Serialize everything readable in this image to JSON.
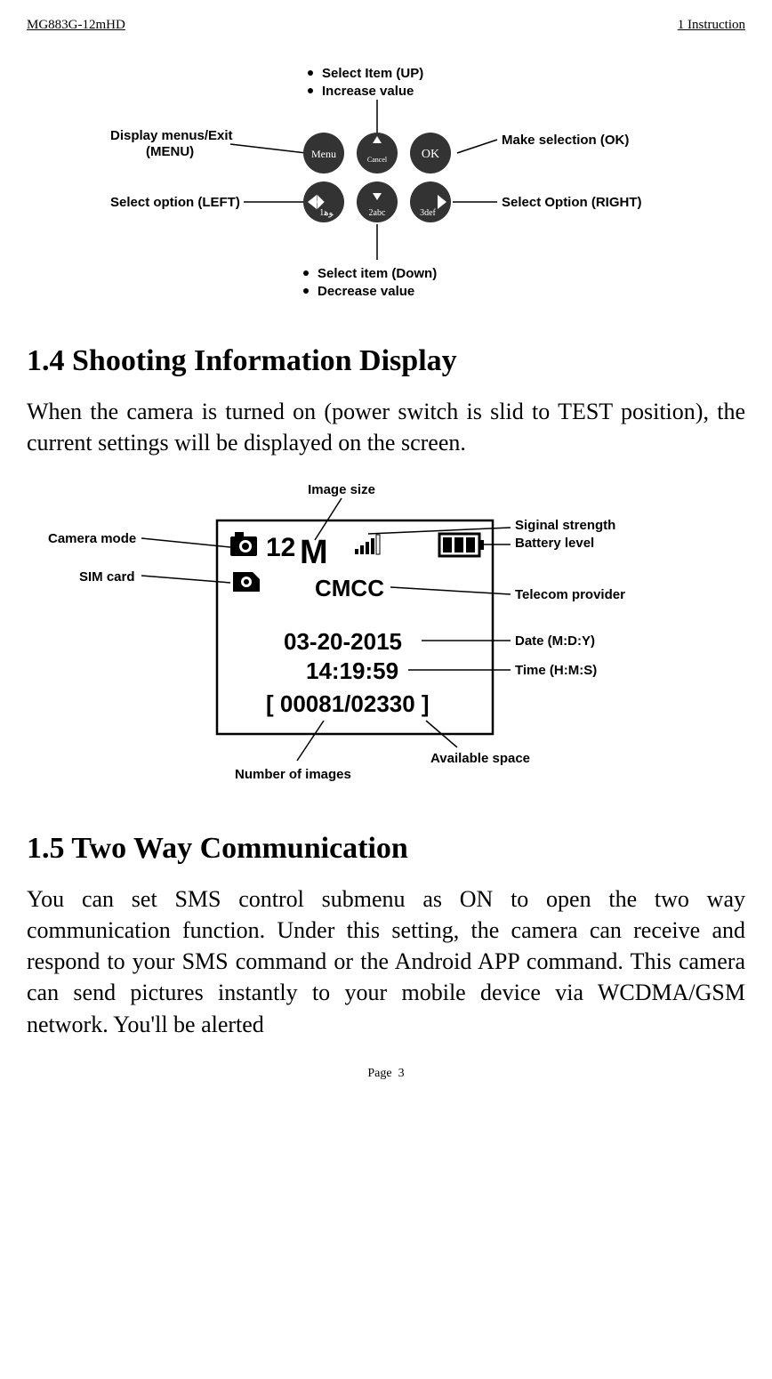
{
  "header": {
    "left": "MG883G-12mHD",
    "right": "1 Instruction"
  },
  "fig1": {
    "selectItemUp": "Select Item (UP)",
    "increaseValue": "Increase value",
    "displayMenus1": "Display menus/Exit",
    "displayMenus2": "(MENU)",
    "makeSelection": "Make selection (OK)",
    "selectOptionLeft": "Select option (LEFT)",
    "selectOptionRight": "Select Option (RIGHT)",
    "selectItemDown": "Select item (Down)",
    "decreaseValue": "Decrease value",
    "menuBtn": "Menu",
    "okBtn": "OK",
    "cancelBtn": "Cancel"
  },
  "section14": {
    "heading": "1.4 Shooting Information Display",
    "para": "When the camera is turned on (power switch is slid to TEST position), the current settings will be displayed on the screen."
  },
  "fig2": {
    "imageSize": "Image size",
    "cameraMode": "Camera mode",
    "simCard": "SIM card",
    "signalStrength": "Siginal strength",
    "batteryLevel": "Battery level",
    "telecomProvider": "Telecom provider",
    "date": "Date (M:D:Y)",
    "time": "Time (H:M:S)",
    "numberImages": "Number of images",
    "availableSpace": "Available space",
    "twelveM": "12",
    "mUnit": "M",
    "cmcc": "CMCC",
    "dateVal": "03-20-2015",
    "timeVal": "14:19:59",
    "counter": "[ 00081/02330 ]"
  },
  "section15": {
    "heading": "1.5 Two Way Communication",
    "para": "You can set SMS control submenu as ON to open the two way communication function. Under this setting, the camera can receive and respond to your SMS command or the Android APP command. This camera can send pictures instantly to your mobile device via WCDMA/GSM network. You'll be alerted"
  },
  "footer": {
    "page": "Page",
    "num": "3"
  }
}
